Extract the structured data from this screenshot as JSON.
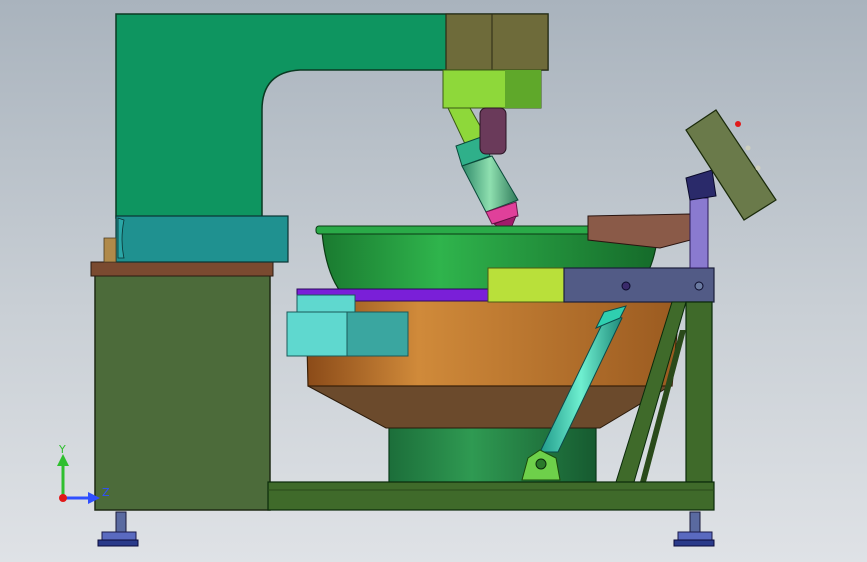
{
  "viewport": {
    "background_top": "#a9b3bd",
    "background_bottom": "#dfe2e6"
  },
  "triad": {
    "y_label": "Y",
    "z_label": "Z",
    "y_color": "#2fbf2f",
    "z_color": "#2f4fff",
    "origin_color": "#e01818"
  },
  "model": {
    "colors": {
      "frame_green": "#0e9a63",
      "column_dark": "#6b6a3a",
      "spindle_lime": "#8fd43a",
      "teal": "#1f8f8f",
      "bowl_green": "#1f9a3f",
      "bowl_orange": "#c07a30",
      "cone_brown": "#6b4a2a",
      "purple": "#7b1fd6",
      "slate": "#4a5a8a",
      "olive_base": "#3f5a2a",
      "cabinet": "#4a6a3a",
      "cyan": "#2fcfb0",
      "foot": "#2a2a6a"
    }
  }
}
